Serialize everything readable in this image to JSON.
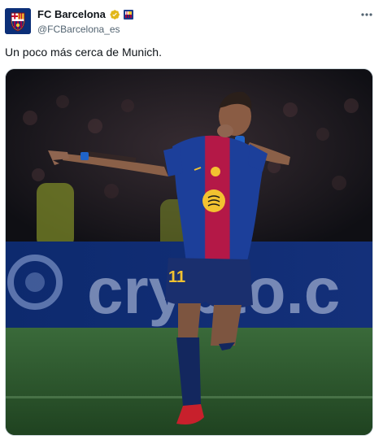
{
  "tweet": {
    "author": {
      "display_name": "FC Barcelona",
      "handle": "@FCBarcelona_es",
      "verified": true,
      "avatar_icon": "fc-barcelona-crest-icon",
      "affiliation_icon": "fc-barcelona-affiliate-badge-icon"
    },
    "more_icon": "more-options-icon",
    "text": "Un poco más cerca de Munich.",
    "media": {
      "type": "photo",
      "banner_text": "crypto.c"
    }
  },
  "colors": {
    "text_primary": "#0f1419",
    "text_secondary": "#536471",
    "verified_gold": "#e2b719",
    "barca_blue": "#0a3a8c",
    "barca_red": "#b1123e"
  }
}
